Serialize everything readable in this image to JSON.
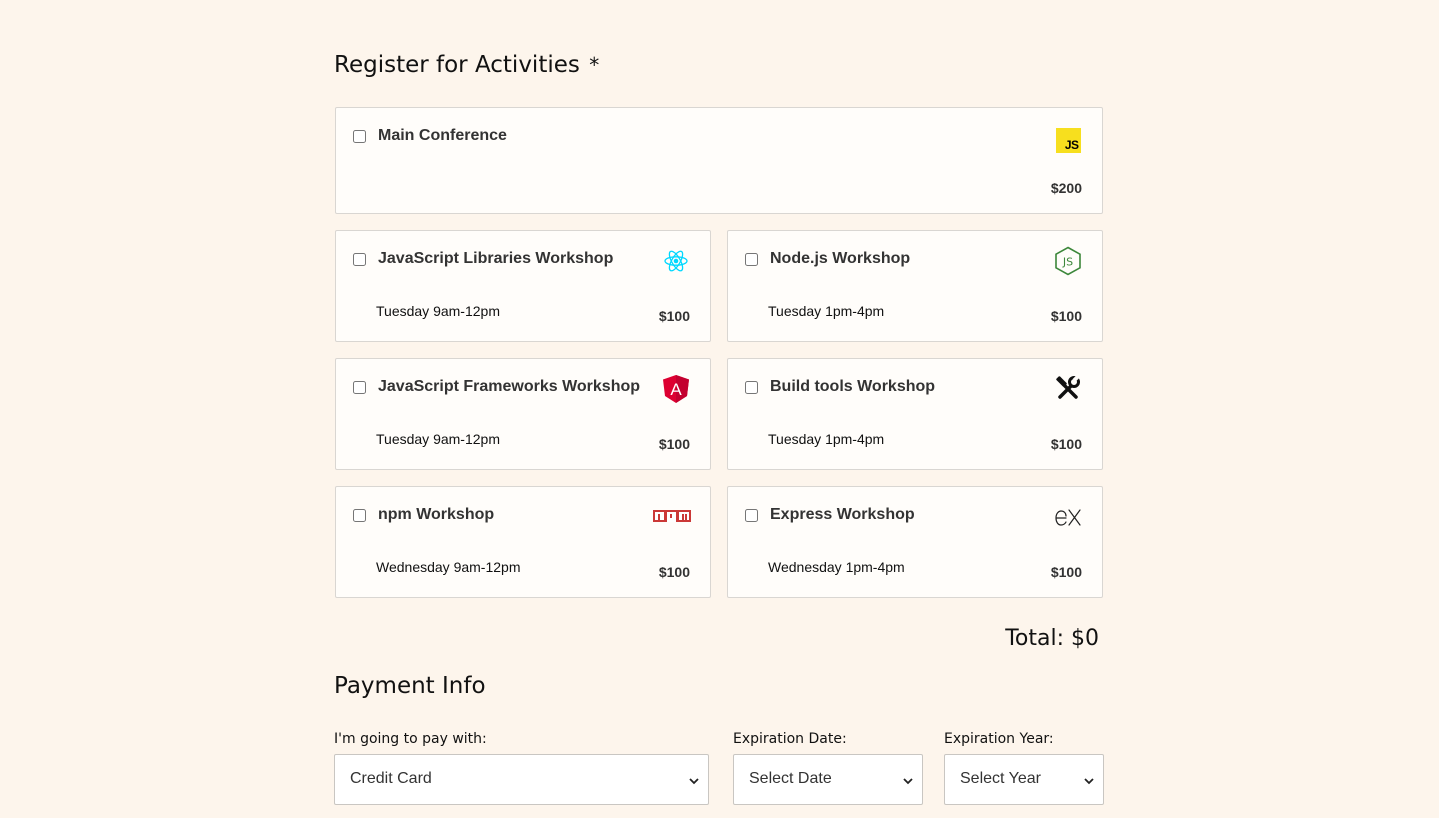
{
  "activities": {
    "title": "Register for Activities",
    "required_mark": "*",
    "main": {
      "name": "Main Conference",
      "price": "$200",
      "icon": "javascript-logo-icon",
      "logo_text": "JS",
      "checked": false
    },
    "workshops": [
      {
        "name": "JavaScript Libraries Workshop",
        "time": "Tuesday 9am-12pm",
        "price": "$100",
        "icon": "react-logo-icon",
        "checked": false
      },
      {
        "name": "Node.js Workshop",
        "time": "Tuesday 1pm-4pm",
        "price": "$100",
        "icon": "nodejs-logo-icon",
        "checked": false
      },
      {
        "name": "JavaScript Frameworks Workshop",
        "time": "Tuesday 9am-12pm",
        "price": "$100",
        "icon": "angular-logo-icon",
        "checked": false
      },
      {
        "name": "Build tools Workshop",
        "time": "Tuesday 1pm-4pm",
        "price": "$100",
        "icon": "hammer-wrench-icon",
        "checked": false
      },
      {
        "name": "npm Workshop",
        "time": "Wednesday 9am-12pm",
        "price": "$100",
        "icon": "npm-logo-icon",
        "checked": false
      },
      {
        "name": "Express Workshop",
        "time": "Wednesday 1pm-4pm",
        "price": "$100",
        "icon": "express-logo-icon",
        "checked": false
      }
    ],
    "total": "Total: $0"
  },
  "payment": {
    "title": "Payment Info",
    "method": {
      "label": "I'm going to pay with:",
      "value": "Credit Card"
    },
    "exp_date": {
      "label": "Expiration Date:",
      "value": "Select Date"
    },
    "exp_year": {
      "label": "Expiration Year:",
      "value": "Select Year"
    }
  },
  "colors": {
    "background": "#fdf5ec",
    "card_background": "#fffdfa",
    "card_border": "#d9d6d2",
    "js_yellow": "#f7df1e",
    "react_cyan": "#00d8ff",
    "node_green": "#3c873a",
    "angular_red": "#dd0031",
    "npm_red": "#cb3837"
  }
}
